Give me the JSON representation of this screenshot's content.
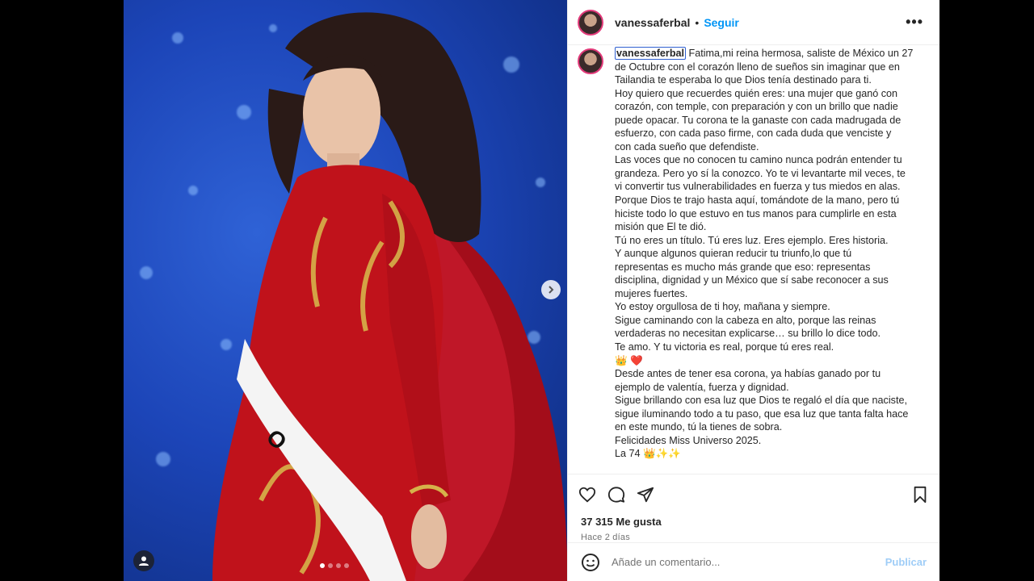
{
  "post": {
    "username": "vanessaferbal",
    "separator": "•",
    "follow_label": "Seguir",
    "more_label": "•••"
  },
  "caption": {
    "username": "vanessaferbal",
    "lines": [
      "Fatima,mi reina hermosa, saliste de México un 27",
      "de Octubre con el corazón lleno de sueños sin imaginar que en",
      "Tailandia te esperaba lo que Dios tenía destinado para ti.",
      "Hoy quiero que recuerdes quién eres: una mujer que ganó con",
      "corazón, con temple, con preparación y con un brillo que nadie",
      "puede opacar. Tu corona te la ganaste con cada madrugada de",
      "esfuerzo, con cada paso firme, con cada duda que venciste y",
      "con cada sueño que defendiste.",
      "Las voces que no conocen tu camino nunca podrán entender tu",
      "grandeza. Pero yo sí la conozco. Yo te vi levantarte mil veces, te",
      "vi convertir tus vulnerabilidades en fuerza y tus miedos en alas.",
      "Porque Dios te trajo hasta aquí, tomándote de la mano, pero tú",
      "hiciste todo lo que estuvo en tus manos para cumplirle en esta",
      "misión que El te dió.",
      "Tú no eres un título. Tú eres luz. Eres ejemplo. Eres historia.",
      "Y aunque algunos quieran reducir tu triunfo,lo que tú",
      "representas es mucho más grande que eso: representas",
      "disciplina, dignidad y un México que sí sabe reconocer a sus",
      "mujeres fuertes.",
      "Yo estoy orgullosa de ti hoy, mañana y siempre.",
      "Sigue caminando con la cabeza en alto, porque las reinas",
      "verdaderas no necesitan explicarse… su brillo lo dice todo.",
      "Te amo. Y tu victoria es real, porque tú eres real."
    ],
    "emoji_line": [
      "👑",
      "❤️"
    ],
    "lines_after": [
      "Desde antes de tener esa corona, ya habías ganado por tu",
      "ejemplo de valentía, fuerza y dignidad.",
      "Sigue brillando con esa luz que Dios te regaló el día que naciste,",
      "sigue iluminando todo a tu paso, que esa luz que tanta falta hace",
      "en este mundo, tú la tienes de sobra.",
      "Felicidades Miss Universo 2025."
    ],
    "last_line_text": "La 74",
    "last_line_emojis": [
      "👑",
      "✨",
      "✨"
    ]
  },
  "stats": {
    "likes": "37 315 Me gusta",
    "time": "Hace 2 días"
  },
  "comment": {
    "placeholder": "Añade un comentario...",
    "publish_label": "Publicar"
  },
  "colors": {
    "accent": "#0095f6",
    "publish_disabled": "#9fcdf7",
    "dress_red": "#c0121b",
    "background": "#1c45b8"
  },
  "carousel": {
    "current_index": 1,
    "total": 4
  }
}
